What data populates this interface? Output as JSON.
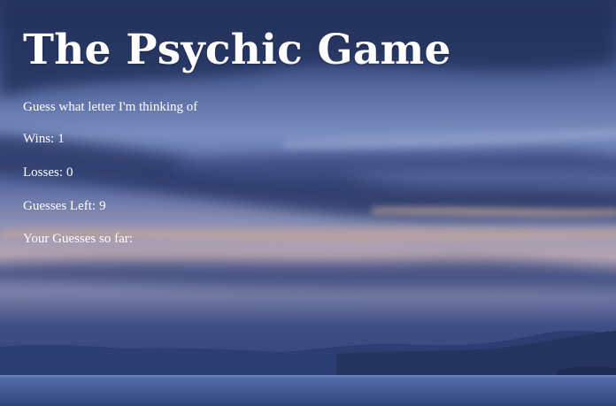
{
  "game": {
    "title": "The Psychic Game",
    "instructions": "Guess what letter I'm thinking of",
    "wins_label": "Wins:",
    "wins": "1",
    "losses_label": "Losses:",
    "losses": "0",
    "guesses_left_label": "Guesses Left:",
    "guesses_left": "9",
    "guesses_so_far_label": "Your Guesses so far:",
    "guesses_so_far": ""
  },
  "colors": {
    "text": "#ffffff",
    "sky_top": "#2b3a6b",
    "sky_mid": "#6b7fb3",
    "horizon_glow": "#c9a48a",
    "water": "#3d5590"
  }
}
